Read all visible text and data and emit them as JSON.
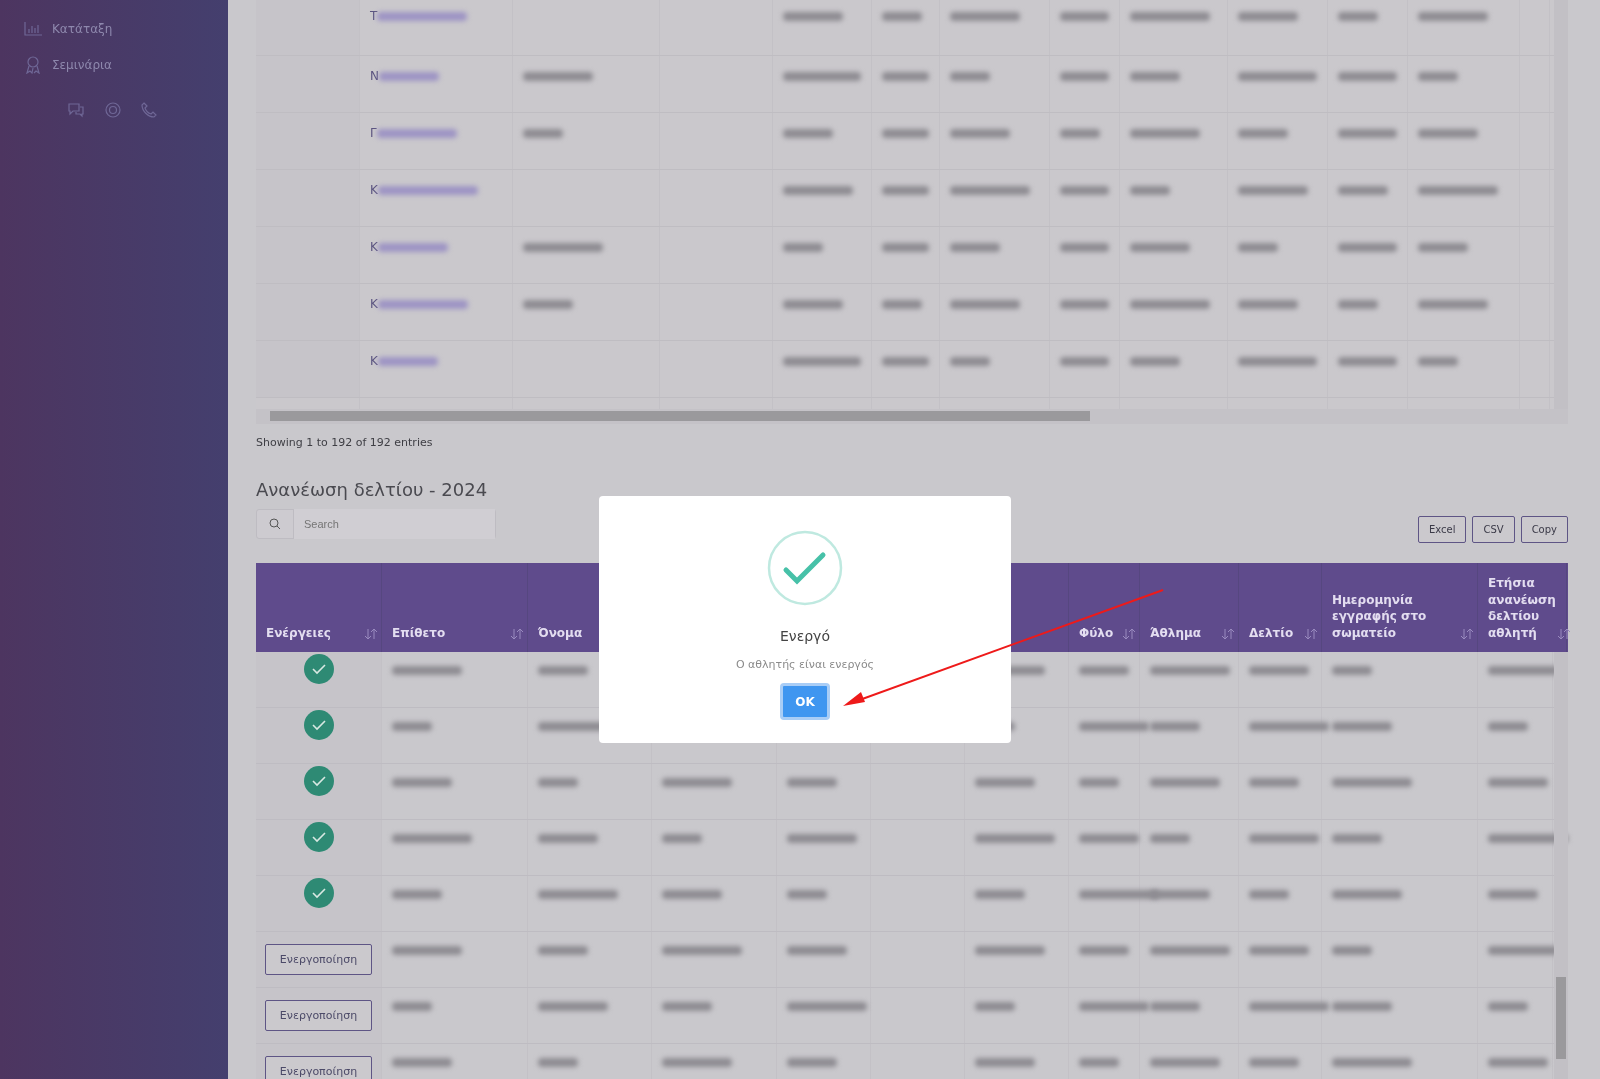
{
  "sidebar": {
    "items": [
      {
        "label": "Κατάταξη"
      },
      {
        "label": "Σεμινάρια"
      }
    ]
  },
  "top_table": {
    "rows": [
      {
        "surname_initial": "Τ"
      },
      {
        "surname_initial": "Ν"
      },
      {
        "surname_initial": "Γ"
      },
      {
        "surname_initial": "Κ"
      },
      {
        "surname_initial": "Κ"
      },
      {
        "surname_initial": "Κ"
      },
      {
        "surname_initial": "Κ"
      }
    ],
    "info": "Showing 1 to 192 of 192 entries"
  },
  "renewal": {
    "title": "Ανανέωση δελτίου - 2024",
    "search": {
      "placeholder": "Search"
    },
    "export_buttons": [
      "Excel",
      "CSV",
      "Copy"
    ],
    "columns": [
      {
        "label": "Ενέργειες"
      },
      {
        "label": "Επίθετο"
      },
      {
        "label": "Όνομα"
      },
      {},
      {},
      {},
      {},
      {
        "label": "Φύλο"
      },
      {
        "label": "Άθλημα"
      },
      {
        "label": "Δελτίο"
      },
      {
        "label": "Ημερομηνία εγγραφής στο σωματείο"
      },
      {
        "label": "Ετήσια ανανέωση δελτίου αθλητή"
      }
    ],
    "rows": [
      {
        "kind": "active"
      },
      {
        "kind": "active"
      },
      {
        "kind": "active"
      },
      {
        "kind": "active"
      },
      {
        "kind": "active"
      },
      {
        "kind": "button",
        "button": "Ενεργοποίηση"
      },
      {
        "kind": "button",
        "button": "Ενεργοποίηση"
      },
      {
        "kind": "button",
        "button": "Ενεργοποίηση"
      }
    ]
  },
  "dialog": {
    "title": "Ενεργό",
    "message": "Ο αθλητής είναι ενεργός",
    "button": "OK"
  }
}
